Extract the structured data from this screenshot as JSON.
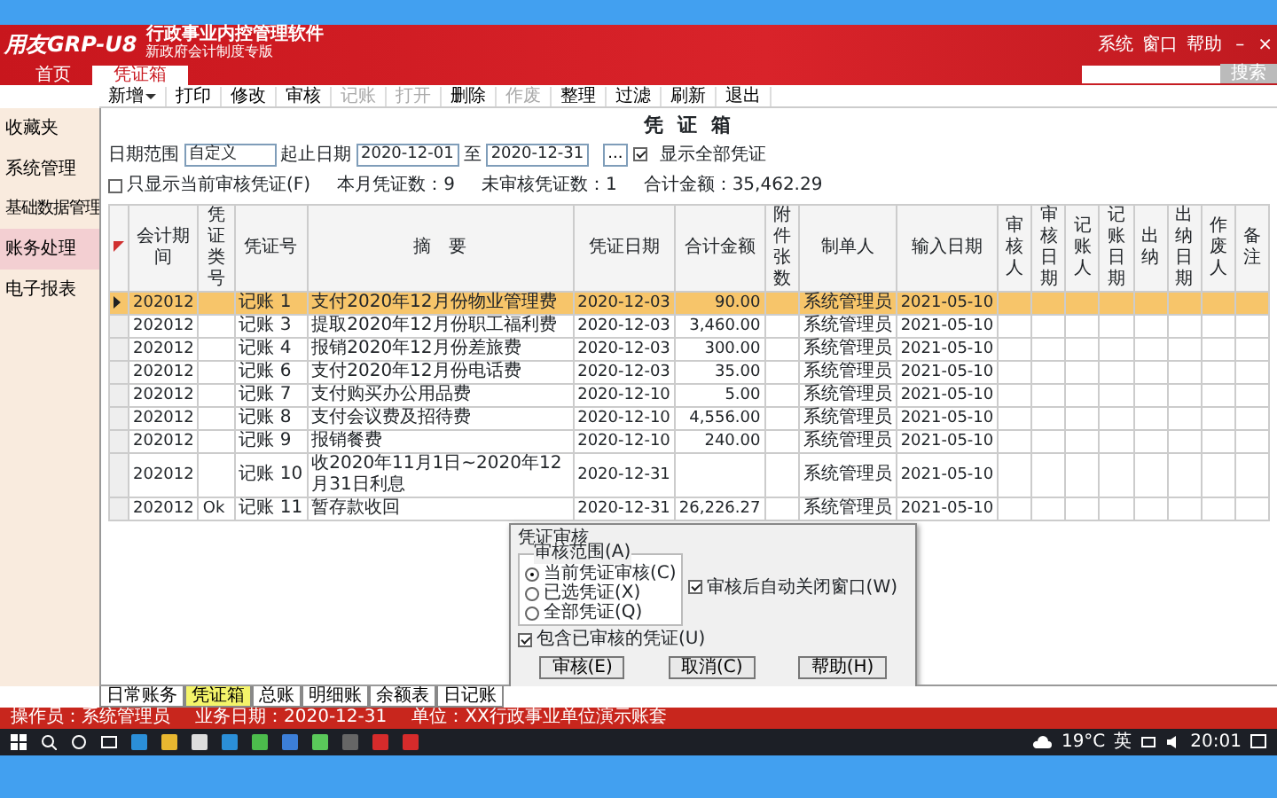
{
  "app": {
    "logo": "用友GRP-U8",
    "title": "行政事业内控管理软件",
    "subtitle": "新政府会计制度专版",
    "menu": [
      "系统",
      "窗口",
      "帮助"
    ],
    "window_controls": [
      "–",
      "×"
    ],
    "search_button": "搜索"
  },
  "tabs": [
    {
      "label": "首页",
      "selected": false
    },
    {
      "label": "凭证箱",
      "selected": true
    }
  ],
  "toolbar": [
    {
      "label": "新增",
      "dropdown": true,
      "disabled": false
    },
    {
      "label": "打印",
      "dropdown": false,
      "disabled": false
    },
    {
      "label": "修改",
      "dropdown": false,
      "disabled": false
    },
    {
      "label": "审核",
      "dropdown": false,
      "disabled": false
    },
    {
      "label": "记账",
      "dropdown": false,
      "disabled": true
    },
    {
      "label": "打开",
      "dropdown": false,
      "disabled": true
    },
    {
      "label": "删除",
      "dropdown": false,
      "disabled": false
    },
    {
      "label": "作废",
      "dropdown": false,
      "disabled": true
    },
    {
      "label": "整理",
      "dropdown": false,
      "disabled": false
    },
    {
      "label": "过滤",
      "dropdown": false,
      "disabled": false
    },
    {
      "label": "刷新",
      "dropdown": false,
      "disabled": false
    },
    {
      "label": "退出",
      "dropdown": false,
      "disabled": false
    }
  ],
  "sidebar": [
    {
      "label": "收藏夹",
      "selected": false
    },
    {
      "label": "系统管理",
      "selected": false
    },
    {
      "label": "基础数据管理",
      "selected": false
    },
    {
      "label": "账务处理",
      "selected": true
    },
    {
      "label": "电子报表",
      "selected": false
    }
  ],
  "page_title": "凭 证 箱",
  "filters": {
    "range_label": "日期范围",
    "range_value": "自定义",
    "from_label": "起止日期",
    "from": "2020-12-01",
    "to_label": "至",
    "to": "2020-12-31",
    "more": "...",
    "show_all": {
      "label": "显示全部凭证",
      "checked": true
    },
    "only_current": {
      "label": "只显示当前审核凭证(F)",
      "checked": false
    }
  },
  "summary": [
    "本月凭证数：9",
    "未审核凭证数：1",
    "合计金额：35,462.29"
  ],
  "table": {
    "columns": [
      "会计期间",
      "凭证类号",
      "凭证号",
      "摘　要",
      "凭证日期",
      "合计金额",
      "附件张数",
      "制单人",
      "输入日期",
      "审核人",
      "审核日期",
      "记账人",
      "记账日期",
      "出纳",
      "出纳日期",
      "作废人",
      "备注"
    ],
    "rows": [
      {
        "selected": true,
        "period": "202012",
        "number": "记账 1",
        "summary": "支付2020年12月份物业管理费",
        "date": "2020-12-03",
        "amount": "90.00",
        "maker": "系统管理员",
        "entry_date": "2021-05-10"
      },
      {
        "selected": false,
        "period": "202012",
        "number": "记账 3",
        "summary": "提取2020年12月份职工福利费",
        "date": "2020-12-03",
        "amount": "3,460.00",
        "maker": "系统管理员",
        "entry_date": "2021-05-10"
      },
      {
        "selected": false,
        "period": "202012",
        "number": "记账 4",
        "summary": "报销2020年12月份差旅费",
        "date": "2020-12-03",
        "amount": "300.00",
        "maker": "系统管理员",
        "entry_date": "2021-05-10"
      },
      {
        "selected": false,
        "period": "202012",
        "number": "记账 6",
        "summary": "支付2020年12月份电话费",
        "date": "2020-12-03",
        "amount": "35.00",
        "maker": "系统管理员",
        "entry_date": "2021-05-10"
      },
      {
        "selected": false,
        "period": "202012",
        "number": "记账 7",
        "summary": "支付购买办公用品费",
        "date": "2020-12-10",
        "amount": "5.00",
        "maker": "系统管理员",
        "entry_date": "2021-05-10"
      },
      {
        "selected": false,
        "period": "202012",
        "number": "记账 8",
        "summary": "支付会议费及招待费",
        "date": "2020-12-10",
        "amount": "4,556.00",
        "maker": "系统管理员",
        "entry_date": "2021-05-10"
      },
      {
        "selected": false,
        "period": "202012",
        "number": "记账 9",
        "summary": "报销餐费",
        "date": "2020-12-10",
        "amount": "240.00",
        "maker": "系统管理员",
        "entry_date": "2021-05-10"
      },
      {
        "selected": false,
        "period": "202012",
        "number": "记账 10",
        "summary": "收2020年11月1日~2020年12月31日利息",
        "date": "2020-12-31",
        "maker": "系统管理员",
        "entry_date": "2021-05-10"
      },
      {
        "selected": false,
        "period": "202012",
        "type": "Ok",
        "number": "记账 11",
        "summary": "暂存款收回",
        "date": "2020-12-31",
        "amount": "26,226.27",
        "maker": "系统管理员",
        "entry_date": "2021-05-10"
      }
    ]
  },
  "dialog": {
    "title": "凭证审核",
    "group": "审核范围(A)",
    "options": [
      {
        "label": "当前凭证审核(C)",
        "selected": true
      },
      {
        "label": "已选凭证(X)",
        "selected": false
      },
      {
        "label": "全部凭证(Q)",
        "selected": false
      }
    ],
    "auto_close": {
      "label": "审核后自动关闭窗口(W)",
      "checked": true
    },
    "include_audited": {
      "label": "包含已审核的凭证(U)",
      "checked": true
    },
    "buttons": [
      "审核(E)",
      "取消(C)",
      "帮助(H)"
    ]
  },
  "sheet_tabs": [
    {
      "label": "日常账务",
      "selected": false
    },
    {
      "label": "凭证箱",
      "selected": true
    },
    {
      "label": "总账",
      "selected": false
    },
    {
      "label": "明细账",
      "selected": false
    },
    {
      "label": "余额表",
      "selected": false
    },
    {
      "label": "日记账",
      "selected": false
    }
  ],
  "status_bar": [
    "操作员：系统管理员",
    "业务日期：2020-12-31",
    "单位：XX行政事业单位演示账套"
  ],
  "taskbar": {
    "weather": "19°C",
    "ime": "英",
    "time": "20:01"
  }
}
